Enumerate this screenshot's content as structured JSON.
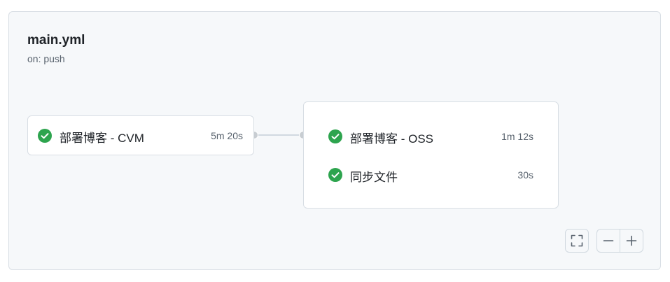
{
  "workflow": {
    "title": "main.yml",
    "trigger": "on: push"
  },
  "jobs": [
    {
      "steps": [
        {
          "name": "部署博客 - CVM",
          "duration": "5m 20s",
          "status": "success"
        }
      ]
    },
    {
      "steps": [
        {
          "name": "部署博客 - OSS",
          "duration": "1m 12s",
          "status": "success"
        },
        {
          "name": "同步文件",
          "duration": "30s",
          "status": "success"
        }
      ]
    }
  ],
  "controls": {
    "fullscreen_icon": "fullscreen-icon",
    "zoom_out_icon": "minus-icon",
    "zoom_in_icon": "plus-icon"
  },
  "colors": {
    "success": "#2da44e",
    "panel_bg": "#f6f8fa",
    "border": "#d8dee4",
    "connector": "#d1d9e0"
  }
}
